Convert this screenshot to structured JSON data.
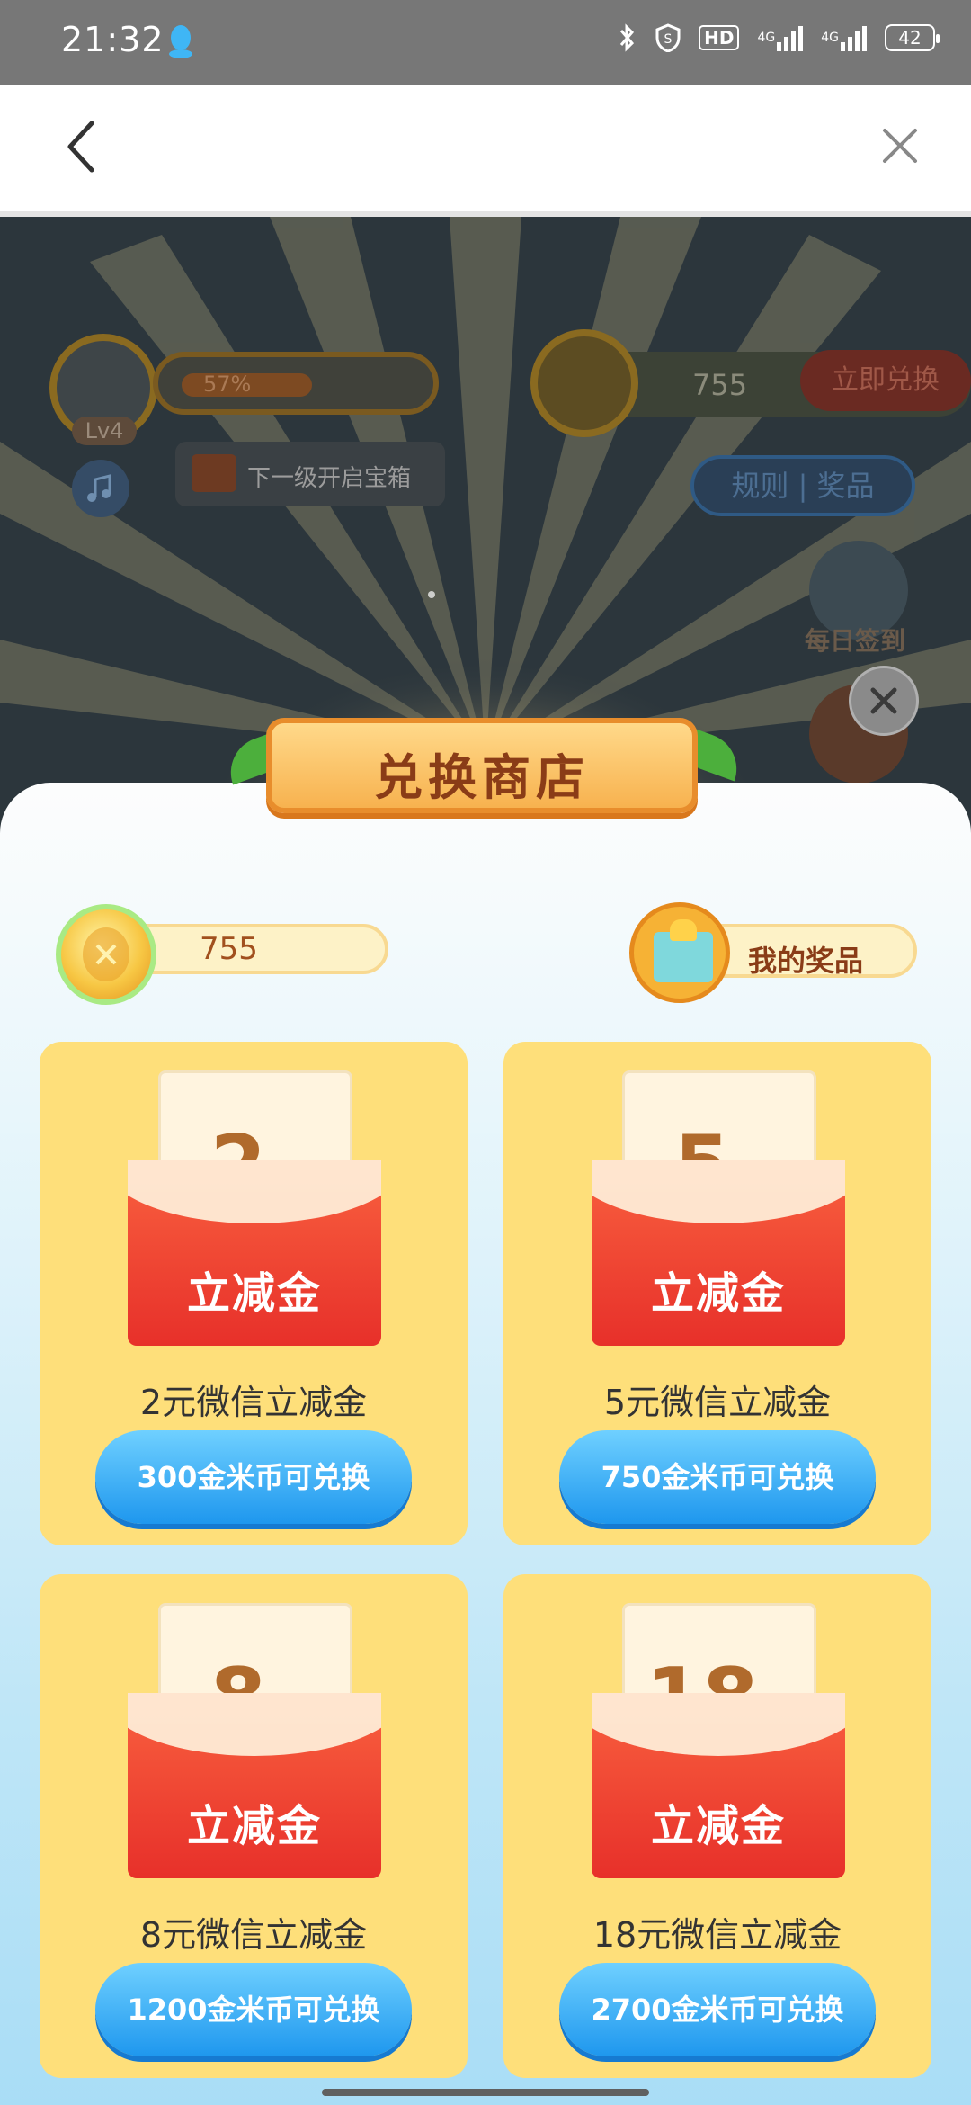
{
  "status_bar": {
    "time": "21:32",
    "hd_label": "HD",
    "sig1_label": "4G",
    "sig2_label": "4G",
    "battery": "42"
  },
  "background_game": {
    "level_percent": "57%",
    "level_tag": "Lv4",
    "chest_tip": "下一级开启宝箱",
    "coin_count": "755",
    "exchange_now": "立即兑换",
    "rules_prizes": "规则 | 奖品",
    "daily_sign": "每日签到"
  },
  "modal": {
    "title": "兑换商店",
    "balance": "755",
    "my_prizes": "我的奖品"
  },
  "cards": [
    {
      "amount": "2",
      "unit": "元",
      "label": "立减金",
      "name": "2元微信立减金",
      "button": "300金米币可兑换"
    },
    {
      "amount": "5",
      "unit": "元",
      "label": "立减金",
      "name": "5元微信立减金",
      "button": "750金米币可兑换"
    },
    {
      "amount": "8",
      "unit": "元",
      "label": "立减金",
      "name": "8元微信立减金",
      "button": "1200金米币可兑换"
    },
    {
      "amount": "18",
      "unit": "元",
      "label": "立减金",
      "name": "18元微信立减金",
      "button": "2700金米币可兑换"
    }
  ],
  "colors": {
    "card_bg": "#fedf7a",
    "button_blue": "#1e97ee",
    "envelope_red": "#e7302a",
    "title_orange": "#f7b24f"
  }
}
